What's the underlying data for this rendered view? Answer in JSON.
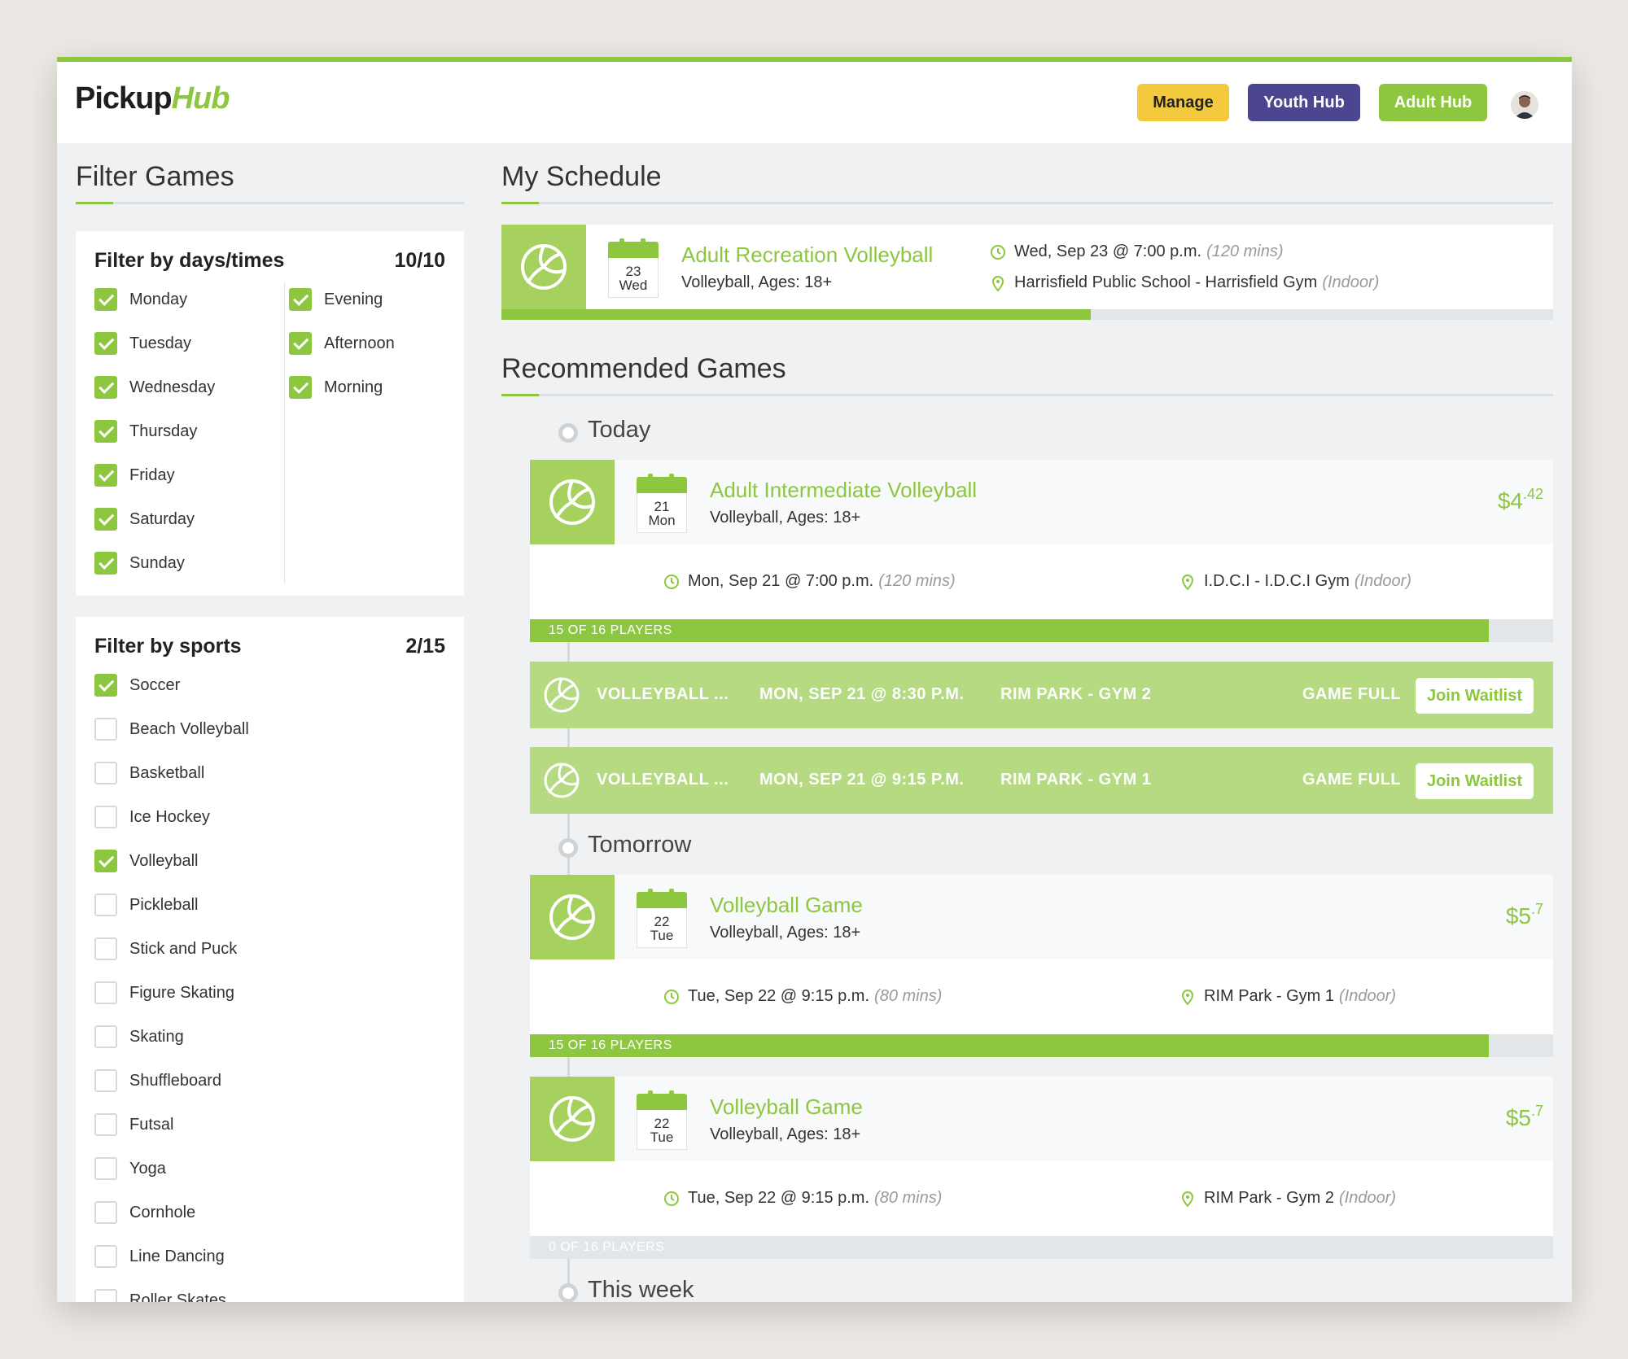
{
  "header": {
    "logo_part1": "Pickup",
    "logo_part2": "Hub",
    "manage_label": "Manage",
    "youth_hub_label": "Youth Hub",
    "adult_hub_label": "Adult Hub"
  },
  "filters": {
    "title": "Filter Games",
    "days_times": {
      "title": "Filter by days/times",
      "count": "10/10",
      "days": [
        {
          "label": "Monday",
          "checked": true
        },
        {
          "label": "Tuesday",
          "checked": true
        },
        {
          "label": "Wednesday",
          "checked": true
        },
        {
          "label": "Thursday",
          "checked": true
        },
        {
          "label": "Friday",
          "checked": true
        },
        {
          "label": "Saturday",
          "checked": true
        },
        {
          "label": "Sunday",
          "checked": true
        }
      ],
      "times": [
        {
          "label": "Evening",
          "checked": true
        },
        {
          "label": "Afternoon",
          "checked": true
        },
        {
          "label": "Morning",
          "checked": true
        }
      ]
    },
    "sports": {
      "title": "Filter by sports",
      "count": "2/15",
      "items": [
        {
          "label": "Soccer",
          "checked": true
        },
        {
          "label": "Beach Volleyball",
          "checked": false
        },
        {
          "label": "Basketball",
          "checked": false
        },
        {
          "label": "Ice Hockey",
          "checked": false
        },
        {
          "label": "Volleyball",
          "checked": true
        },
        {
          "label": "Pickleball",
          "checked": false
        },
        {
          "label": "Stick and Puck",
          "checked": false
        },
        {
          "label": "Figure Skating",
          "checked": false
        },
        {
          "label": "Skating",
          "checked": false
        },
        {
          "label": "Shuffleboard",
          "checked": false
        },
        {
          "label": "Futsal",
          "checked": false
        },
        {
          "label": "Yoga",
          "checked": false
        },
        {
          "label": "Cornhole",
          "checked": false
        },
        {
          "label": "Line Dancing",
          "checked": false
        },
        {
          "label": "Roller Skates",
          "checked": false
        }
      ]
    }
  },
  "schedule": {
    "title": "My Schedule",
    "game": {
      "day": "23",
      "weekday": "Wed",
      "title": "Adult Recreation Volleyball",
      "subtitle": "Volleyball, Ages: 18+",
      "when": "Wed, Sep 23 @ 7:00 p.m.",
      "duration": "(120 mins)",
      "where": "Harrisfield Public School - Harrisfield Gym",
      "venue_type": "(Indoor)",
      "progress": 0.56
    }
  },
  "recommended": {
    "title": "Recommended Games",
    "groups": {
      "today": "Today",
      "tomorrow": "Tomorrow",
      "this_week": "This week"
    },
    "cards": [
      {
        "day": "21",
        "weekday": "Mon",
        "title": "Adult Intermediate Volleyball",
        "subtitle": "Volleyball, Ages: 18+",
        "price_main": "$4",
        "price_cents": ".42",
        "when": "Mon, Sep 21 @ 7:00 p.m.",
        "duration": "(120 mins)",
        "where": "I.D.C.I - I.D.C.I Gym",
        "venue_type": "(Indoor)",
        "players_label": "15 OF 16 PLAYERS",
        "fill": 0.9375
      },
      {
        "day": "22",
        "weekday": "Tue",
        "title": "Volleyball Game",
        "subtitle": "Volleyball, Ages: 18+",
        "price_main": "$5",
        "price_cents": ".7",
        "when": "Tue, Sep 22 @ 9:15 p.m.",
        "duration": "(80 mins)",
        "where": "RIM Park - Gym 1",
        "venue_type": "(Indoor)",
        "players_label": "15 OF 16 PLAYERS",
        "fill": 0.9375
      },
      {
        "day": "22",
        "weekday": "Tue",
        "title": "Volleyball Game",
        "subtitle": "Volleyball, Ages: 18+",
        "price_main": "$5",
        "price_cents": ".7",
        "when": "Tue, Sep 22 @ 9:15 p.m.",
        "duration": "(80 mins)",
        "where": "RIM Park - Gym 2",
        "venue_type": "(Indoor)",
        "players_label": "0 OF 16 PLAYERS",
        "fill": 0
      }
    ],
    "full_games": [
      {
        "sport": "VOLLEYBALL ...",
        "when": "MON, SEP 21 @ 8:30 P.M.",
        "where": "RIM PARK - GYM 2",
        "status": "GAME FULL",
        "action": "Join Waitlist"
      },
      {
        "sport": "VOLLEYBALL ...",
        "when": "MON, SEP 21 @ 9:15 P.M.",
        "where": "RIM PARK - GYM 1",
        "status": "GAME FULL",
        "action": "Join Waitlist"
      }
    ]
  },
  "colors": {
    "accent": "#8dc63f",
    "manage": "#f3c93e",
    "youth": "#4b468f",
    "light_green": "#b5da82"
  }
}
